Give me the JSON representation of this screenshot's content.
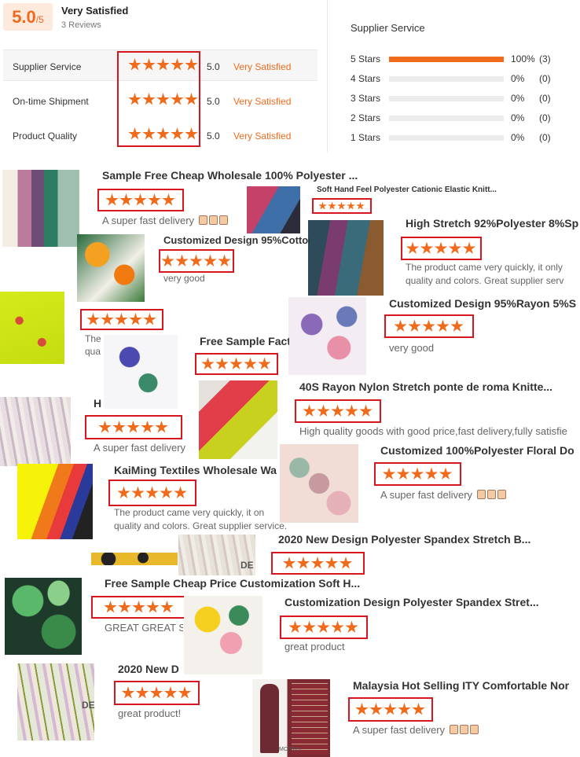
{
  "summary": {
    "score": "5.0",
    "score_max": "/5",
    "label": "Very Satisfied",
    "reviews": "3 Reviews"
  },
  "categories": [
    {
      "label": "Supplier Service",
      "rating": 5,
      "value": "5.0",
      "text": "Very Satisfied"
    },
    {
      "label": "On-time Shipment",
      "rating": 5,
      "value": "5.0",
      "text": "Very Satisfied"
    },
    {
      "label": "Product Quality",
      "rating": 5,
      "value": "5.0",
      "text": "Very Satisfied"
    }
  ],
  "distribution": {
    "title": "Supplier Service",
    "rows": [
      {
        "label": "5 Stars",
        "fraction": 1,
        "pct": "100%",
        "count": "(3)"
      },
      {
        "label": "4 Stars",
        "fraction": 0,
        "pct": "0%",
        "count": "(0)"
      },
      {
        "label": "3 Stars",
        "fraction": 0,
        "pct": "0%",
        "count": "(0)"
      },
      {
        "label": "2 Stars",
        "fraction": 0,
        "pct": "0%",
        "count": "(0)"
      },
      {
        "label": "1 Stars",
        "fraction": 0,
        "pct": "0%",
        "count": "(0)"
      }
    ]
  },
  "colors": {
    "accent": "#f06a1c",
    "highlight_box": "#d8161f"
  },
  "cards": [
    {
      "title": "Sample Free Cheap Wholesale 100% Polyester ...",
      "sub": "A super fast delivery",
      "thumbs": 3
    },
    {
      "title": "Soft Hand Feel Polyester Cationic Elastic Knitt...",
      "sub": "",
      "thumbs": 0
    },
    {
      "title": "High Stretch 92%Polyester 8%Sp",
      "sub": "The product came very quickly, it only",
      "sub2": "quality and colors. Great supplier serv",
      "thumbs": 0
    },
    {
      "title": "Customized Design 95%Cotton",
      "sub": "very good",
      "thumbs": 0
    },
    {
      "title": "Customized Design 95%Rayon 5%S",
      "sub": "very good",
      "thumbs": 0
    },
    {
      "title": "",
      "sub": "The",
      "sub2": "qua",
      "thumbs": 0
    },
    {
      "title": "Free Sample Fact",
      "sub": "",
      "thumbs": 0
    },
    {
      "title": "40S Rayon Nylon Stretch ponte de roma Knitte...",
      "sub": "High quality goods with good price,fast delivery,fully satisfie",
      "thumbs": 0
    },
    {
      "title": "H",
      "sub": "A super fast delivery",
      "thumbs": 0
    },
    {
      "title": "Customized 100%Polyester Floral Do",
      "sub": "A super fast delivery",
      "thumbs": 3
    },
    {
      "title": "KaiMing Textiles Wholesale Wa",
      "sub": "The product came very quickly, it on",
      "sub2": "quality and colors. Great supplier service.",
      "thumbs": 0
    },
    {
      "title": "2020 New Design Polyester Spandex Stretch B...",
      "sub": "",
      "thumbs": 0
    },
    {
      "title": "Free Sample Cheap Price Customization Soft H...",
      "sub": "GREAT GREAT S",
      "thumbs": 0
    },
    {
      "title": "Customization Design Polyester Spandex Stret...",
      "sub": "great product",
      "thumbs": 0
    },
    {
      "title": "2020 New D",
      "sub": "great product!",
      "thumbs": 0
    },
    {
      "title": "Malaysia Hot Selling ITY Comfortable Nor",
      "sub": "A super fast delivery",
      "thumbs": 3
    }
  ],
  "thumb_labels": {
    "de_tag": "DE",
    "model_code": "MCP915"
  }
}
